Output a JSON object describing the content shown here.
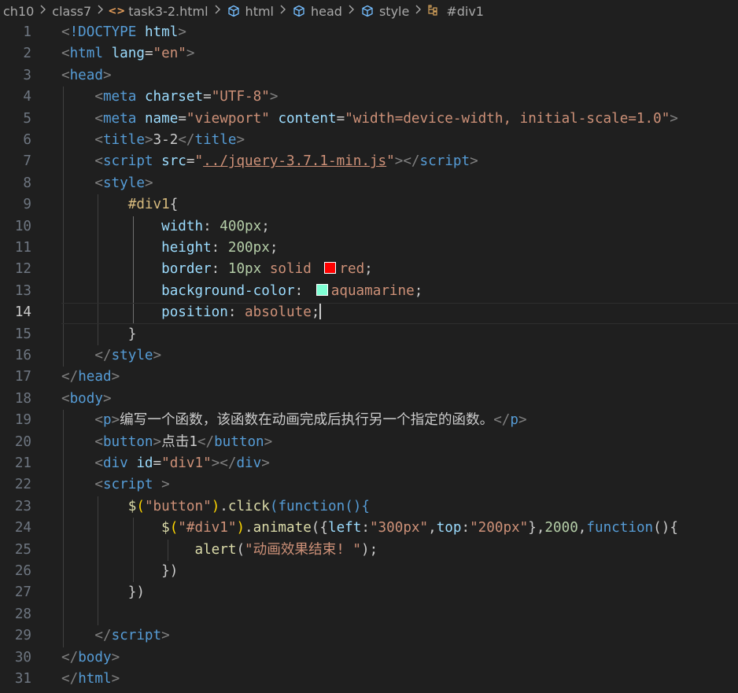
{
  "breadcrumb": [
    {
      "label": "ch10",
      "icon": ""
    },
    {
      "label": "class7",
      "icon": ""
    },
    {
      "label": "task3-2.html",
      "icon": "html-file-icon"
    },
    {
      "label": "html",
      "icon": "element-cube-icon"
    },
    {
      "label": "head",
      "icon": "element-cube-icon"
    },
    {
      "label": "style",
      "icon": "element-cube-icon"
    },
    {
      "label": "#div1",
      "icon": "css-selector-icon"
    }
  ],
  "colors": {
    "background": "#1f1f1f",
    "red_swatch": "#ff0000",
    "aquamarine_swatch": "#7fffd4"
  },
  "editor": {
    "cursor_line": 14,
    "lines": [
      {
        "n": "1",
        "tokens": [
          [
            "punc",
            "<"
          ],
          [
            "tag",
            "!DOCTYPE"
          ],
          [
            "text",
            " "
          ],
          [
            "attr",
            "html"
          ],
          [
            "punc",
            ">"
          ]
        ]
      },
      {
        "n": "2",
        "tokens": [
          [
            "punc",
            "<"
          ],
          [
            "tag",
            "html"
          ],
          [
            "text",
            " "
          ],
          [
            "attr",
            "lang"
          ],
          [
            "text",
            "="
          ],
          [
            "str",
            "\"en\""
          ],
          [
            "punc",
            ">"
          ]
        ]
      },
      {
        "n": "3",
        "tokens": [
          [
            "punc",
            "<"
          ],
          [
            "tag",
            "head"
          ],
          [
            "punc",
            ">"
          ]
        ]
      },
      {
        "n": "4",
        "tokens": [
          [
            "text",
            "    "
          ],
          [
            "punc",
            "<"
          ],
          [
            "tag",
            "meta"
          ],
          [
            "text",
            " "
          ],
          [
            "attr",
            "charset"
          ],
          [
            "text",
            "="
          ],
          [
            "str",
            "\"UTF-8\""
          ],
          [
            "punc",
            ">"
          ]
        ]
      },
      {
        "n": "5",
        "tokens": [
          [
            "text",
            "    "
          ],
          [
            "punc",
            "<"
          ],
          [
            "tag",
            "meta"
          ],
          [
            "text",
            " "
          ],
          [
            "attr",
            "name"
          ],
          [
            "text",
            "="
          ],
          [
            "str",
            "\"viewport\""
          ],
          [
            "text",
            " "
          ],
          [
            "attr",
            "content"
          ],
          [
            "text",
            "="
          ],
          [
            "str",
            "\"width=device-width, initial-scale=1.0\""
          ],
          [
            "punc",
            ">"
          ]
        ]
      },
      {
        "n": "6",
        "tokens": [
          [
            "text",
            "    "
          ],
          [
            "punc",
            "<"
          ],
          [
            "tag",
            "title"
          ],
          [
            "punc",
            ">"
          ],
          [
            "text",
            "3-2"
          ],
          [
            "punc",
            "</"
          ],
          [
            "tag",
            "title"
          ],
          [
            "punc",
            ">"
          ]
        ]
      },
      {
        "n": "7",
        "tokens": [
          [
            "text",
            "    "
          ],
          [
            "punc",
            "<"
          ],
          [
            "tag",
            "script"
          ],
          [
            "text",
            " "
          ],
          [
            "attr",
            "src"
          ],
          [
            "text",
            "="
          ],
          [
            "str",
            "\""
          ],
          [
            "link",
            "../jquery-3.7.1-min.js"
          ],
          [
            "str",
            "\""
          ],
          [
            "punc",
            "></"
          ],
          [
            "tag",
            "script"
          ],
          [
            "punc",
            ">"
          ]
        ]
      },
      {
        "n": "8",
        "tokens": [
          [
            "text",
            "    "
          ],
          [
            "punc",
            "<"
          ],
          [
            "tag",
            "style"
          ],
          [
            "punc",
            ">"
          ]
        ]
      },
      {
        "n": "9",
        "tokens": [
          [
            "text",
            "        "
          ],
          [
            "sel",
            "#div1"
          ],
          [
            "text",
            "{"
          ]
        ]
      },
      {
        "n": "10",
        "tokens": [
          [
            "text",
            "            "
          ],
          [
            "prop",
            "width"
          ],
          [
            "text",
            ": "
          ],
          [
            "num",
            "400px"
          ],
          [
            "text",
            ";"
          ]
        ]
      },
      {
        "n": "11",
        "tokens": [
          [
            "text",
            "            "
          ],
          [
            "prop",
            "height"
          ],
          [
            "text",
            ": "
          ],
          [
            "num",
            "200px"
          ],
          [
            "text",
            ";"
          ]
        ]
      },
      {
        "n": "12",
        "tokens": [
          [
            "text",
            "            "
          ],
          [
            "prop",
            "border"
          ],
          [
            "text",
            ": "
          ],
          [
            "num",
            "10px"
          ],
          [
            "text",
            " "
          ],
          [
            "str",
            "solid"
          ],
          [
            "text",
            " "
          ],
          [
            "swatch",
            "#ff0000"
          ],
          [
            "str",
            "red"
          ],
          [
            "text",
            ";"
          ]
        ]
      },
      {
        "n": "13",
        "tokens": [
          [
            "text",
            "            "
          ],
          [
            "prop",
            "background-color"
          ],
          [
            "text",
            ": "
          ],
          [
            "swatch",
            "#7fffd4"
          ],
          [
            "str",
            "aquamarine"
          ],
          [
            "text",
            ";"
          ]
        ]
      },
      {
        "n": "14",
        "tokens": [
          [
            "text",
            "            "
          ],
          [
            "prop",
            "position"
          ],
          [
            "text",
            ": "
          ],
          [
            "str",
            "absolute"
          ],
          [
            "text",
            ";"
          ],
          [
            "caret",
            ""
          ]
        ]
      },
      {
        "n": "15",
        "tokens": [
          [
            "text",
            "        }"
          ]
        ]
      },
      {
        "n": "16",
        "tokens": [
          [
            "text",
            "    "
          ],
          [
            "punc",
            "</"
          ],
          [
            "tag",
            "style"
          ],
          [
            "punc",
            ">"
          ]
        ]
      },
      {
        "n": "17",
        "tokens": [
          [
            "punc",
            "</"
          ],
          [
            "tag",
            "head"
          ],
          [
            "punc",
            ">"
          ]
        ]
      },
      {
        "n": "18",
        "tokens": [
          [
            "punc",
            "<"
          ],
          [
            "tag",
            "body"
          ],
          [
            "punc",
            ">"
          ]
        ]
      },
      {
        "n": "19",
        "tokens": [
          [
            "text",
            "    "
          ],
          [
            "punc",
            "<"
          ],
          [
            "tag",
            "p"
          ],
          [
            "punc",
            ">"
          ],
          [
            "text",
            "编写一个函数，该函数在动画完成后执行另一个指定的函数。"
          ],
          [
            "punc",
            "</"
          ],
          [
            "tag",
            "p"
          ],
          [
            "punc",
            ">"
          ]
        ]
      },
      {
        "n": "20",
        "tokens": [
          [
            "text",
            "    "
          ],
          [
            "punc",
            "<"
          ],
          [
            "tag",
            "button"
          ],
          [
            "punc",
            ">"
          ],
          [
            "text",
            "点击1"
          ],
          [
            "punc",
            "</"
          ],
          [
            "tag",
            "button"
          ],
          [
            "punc",
            ">"
          ]
        ]
      },
      {
        "n": "21",
        "tokens": [
          [
            "text",
            "    "
          ],
          [
            "punc",
            "<"
          ],
          [
            "tag",
            "div"
          ],
          [
            "text",
            " "
          ],
          [
            "attr",
            "id"
          ],
          [
            "text",
            "="
          ],
          [
            "str",
            "\"div1\""
          ],
          [
            "punc",
            "></"
          ],
          [
            "tag",
            "div"
          ],
          [
            "punc",
            ">"
          ]
        ]
      },
      {
        "n": "22",
        "tokens": [
          [
            "text",
            "    "
          ],
          [
            "punc",
            "<"
          ],
          [
            "tag",
            "script"
          ],
          [
            "text",
            " "
          ],
          [
            "punc",
            ">"
          ]
        ]
      },
      {
        "n": "23",
        "tokens": [
          [
            "text",
            "        "
          ],
          [
            "fn",
            "$"
          ],
          [
            "bracket",
            "("
          ],
          [
            "str",
            "\"button\""
          ],
          [
            "bracket",
            ")"
          ],
          [
            "text",
            "."
          ],
          [
            "fn",
            "click"
          ],
          [
            "kw",
            "("
          ],
          [
            "kw",
            "function"
          ],
          [
            "kw",
            "(){"
          ]
        ]
      },
      {
        "n": "24",
        "tokens": [
          [
            "text",
            "            "
          ],
          [
            "fn",
            "$"
          ],
          [
            "bracket",
            "("
          ],
          [
            "str",
            "\"#div1\""
          ],
          [
            "bracket",
            ")"
          ],
          [
            "text",
            "."
          ],
          [
            "fn",
            "animate"
          ],
          [
            "text",
            "({"
          ],
          [
            "prop",
            "left"
          ],
          [
            "text",
            ":"
          ],
          [
            "str",
            "\"300px\""
          ],
          [
            "text",
            ","
          ],
          [
            "prop",
            "top"
          ],
          [
            "text",
            ":"
          ],
          [
            "str",
            "\"200px\""
          ],
          [
            "text",
            "},"
          ],
          [
            "num",
            "2000"
          ],
          [
            "text",
            ","
          ],
          [
            "kw",
            "function"
          ],
          [
            "text",
            "(){"
          ]
        ]
      },
      {
        "n": "25",
        "tokens": [
          [
            "text",
            "                "
          ],
          [
            "fn",
            "alert"
          ],
          [
            "text",
            "("
          ],
          [
            "str",
            "\"动画效果结束! \""
          ],
          [
            "text",
            ");"
          ]
        ]
      },
      {
        "n": "26",
        "tokens": [
          [
            "text",
            "            })"
          ]
        ]
      },
      {
        "n": "27",
        "tokens": [
          [
            "text",
            "        })"
          ]
        ]
      },
      {
        "n": "28",
        "tokens": []
      },
      {
        "n": "29",
        "tokens": [
          [
            "text",
            "    "
          ],
          [
            "punc",
            "</"
          ],
          [
            "tag",
            "script"
          ],
          [
            "punc",
            ">"
          ]
        ]
      },
      {
        "n": "30",
        "tokens": [
          [
            "punc",
            "</"
          ],
          [
            "tag",
            "body"
          ],
          [
            "punc",
            ">"
          ]
        ]
      },
      {
        "n": "31",
        "tokens": [
          [
            "punc",
            "</"
          ],
          [
            "tag",
            "html"
          ],
          [
            "punc",
            ">"
          ]
        ]
      }
    ]
  }
}
